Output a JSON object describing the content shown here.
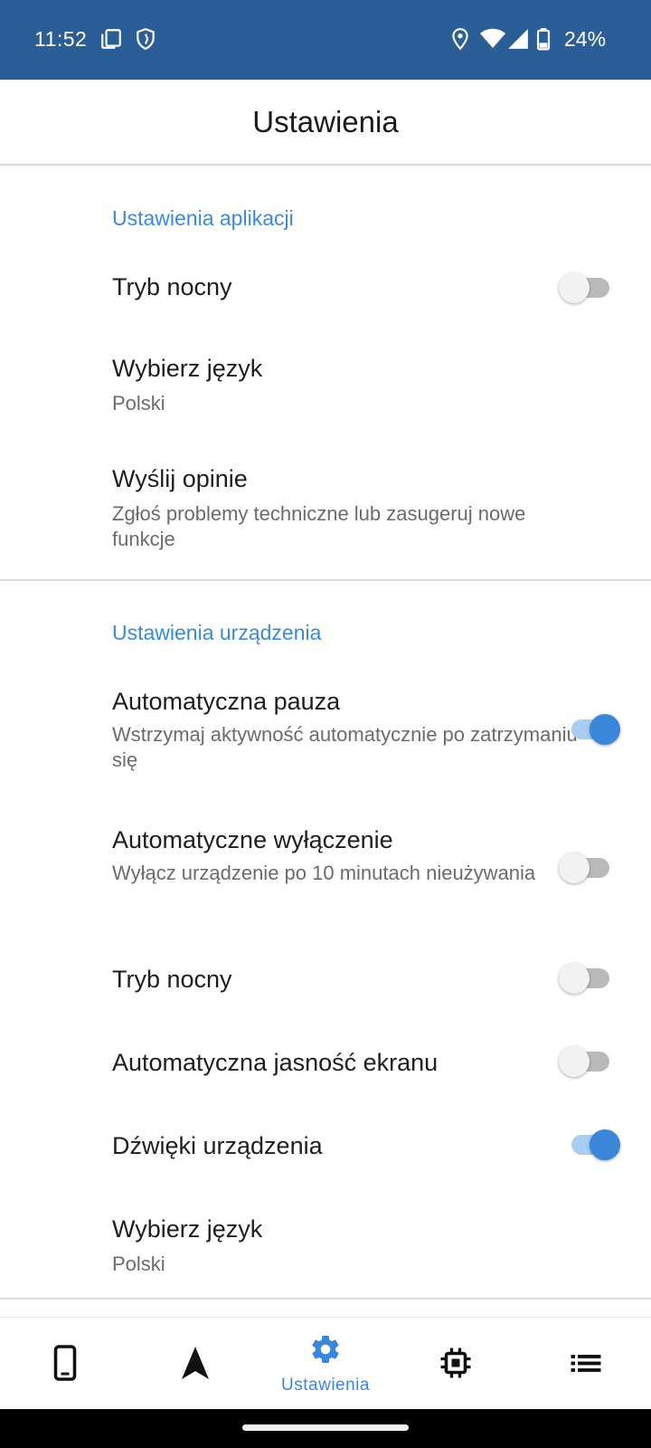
{
  "status_bar": {
    "time": "11:52",
    "battery": "24%",
    "icons": [
      "copy-icon",
      "shield-icon",
      "location-icon",
      "wifi-icon",
      "signal-icon",
      "battery-icon"
    ]
  },
  "header": {
    "title": "Ustawienia"
  },
  "app_settings": {
    "header": "Ustawienia aplikacji",
    "items": [
      {
        "title": "Tryb nocny",
        "toggle": false
      },
      {
        "title": "Wybierz język",
        "subtitle": "Polski"
      },
      {
        "title": "Wyślij opinie",
        "subtitle": "Zgłoś problemy techniczne lub zasugeruj nowe funkcje"
      }
    ]
  },
  "device_settings": {
    "header": "Ustawienia urządzenia",
    "items": [
      {
        "title": "Automatyczna pauza",
        "subtitle": "Wstrzymaj aktywność automatycznie po zatrzymaniu się",
        "toggle": true
      },
      {
        "title": "Automatyczne wyłączenie",
        "subtitle": "Wyłącz urządzenie po 10 minutach nieużywania",
        "toggle": false
      },
      {
        "title": "Tryb nocny",
        "toggle": false
      },
      {
        "title": "Automatyczna jasność ekranu",
        "toggle": false
      },
      {
        "title": "Dźwięki urządzenia",
        "toggle": true
      },
      {
        "title": "Wybierz język",
        "subtitle": "Polski"
      }
    ]
  },
  "bottom_nav": {
    "items": [
      {
        "icon": "phone-icon",
        "label": ""
      },
      {
        "icon": "navigation-arrow-icon",
        "label": ""
      },
      {
        "icon": "gear-icon",
        "label": "Ustawienia",
        "active": true
      },
      {
        "icon": "chip-icon",
        "label": ""
      },
      {
        "icon": "list-icon",
        "label": ""
      }
    ]
  },
  "colors": {
    "status_bar": "#2b5e96",
    "accent": "#3a86d8",
    "section_header": "#3a8ad8"
  }
}
